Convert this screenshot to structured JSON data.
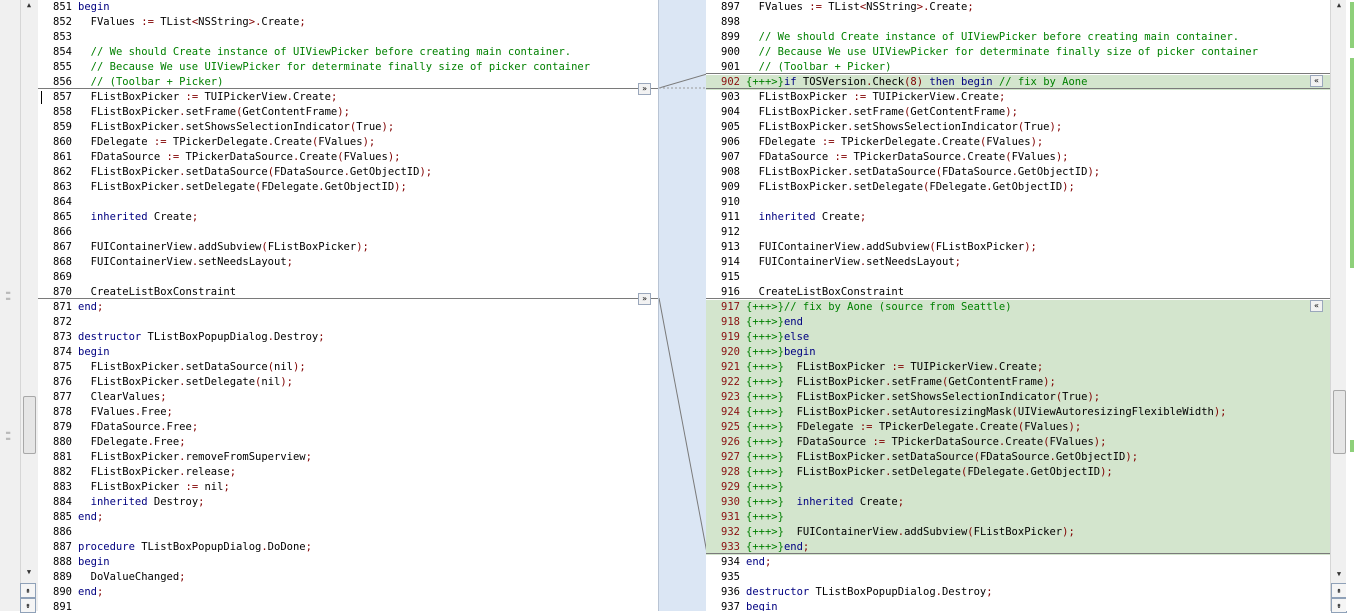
{
  "left": {
    "lines": [
      {
        "n": "851",
        "code": "begin"
      },
      {
        "n": "852",
        "code": "  FValues := TList<NSString>.Create;"
      },
      {
        "n": "853",
        "code": ""
      },
      {
        "n": "854",
        "code": "  // We should Create instance of UIViewPicker before creating main container."
      },
      {
        "n": "855",
        "code": "  // Because We use UIViewPicker for determinate finally size of picker container"
      },
      {
        "n": "856",
        "code": "  // (Toolbar + Picker)"
      },
      {
        "n": "857",
        "code": "  FListBoxPicker := TUIPickerView.Create;"
      },
      {
        "n": "858",
        "code": "  FListBoxPicker.setFrame(GetContentFrame);"
      },
      {
        "n": "859",
        "code": "  FListBoxPicker.setShowsSelectionIndicator(True);"
      },
      {
        "n": "860",
        "code": "  FDelegate := TPickerDelegate.Create(FValues);"
      },
      {
        "n": "861",
        "code": "  FDataSource := TPickerDataSource.Create(FValues);"
      },
      {
        "n": "862",
        "code": "  FListBoxPicker.setDataSource(FDataSource.GetObjectID);"
      },
      {
        "n": "863",
        "code": "  FListBoxPicker.setDelegate(FDelegate.GetObjectID);"
      },
      {
        "n": "864",
        "code": ""
      },
      {
        "n": "865",
        "code": "  inherited Create;"
      },
      {
        "n": "866",
        "code": ""
      },
      {
        "n": "867",
        "code": "  FUIContainerView.addSubview(FListBoxPicker);"
      },
      {
        "n": "868",
        "code": "  FUIContainerView.setNeedsLayout;"
      },
      {
        "n": "869",
        "code": ""
      },
      {
        "n": "870",
        "code": "  CreateListBoxConstraint"
      },
      {
        "n": "871",
        "code": "end;"
      },
      {
        "n": "872",
        "code": ""
      },
      {
        "n": "873",
        "code": "destructor TListBoxPopupDialog.Destroy;"
      },
      {
        "n": "874",
        "code": "begin"
      },
      {
        "n": "875",
        "code": "  FListBoxPicker.setDataSource(nil);"
      },
      {
        "n": "876",
        "code": "  FListBoxPicker.setDelegate(nil);"
      },
      {
        "n": "877",
        "code": "  ClearValues;"
      },
      {
        "n": "878",
        "code": "  FValues.Free;"
      },
      {
        "n": "879",
        "code": "  FDataSource.Free;"
      },
      {
        "n": "880",
        "code": "  FDelegate.Free;"
      },
      {
        "n": "881",
        "code": "  FListBoxPicker.removeFromSuperview;"
      },
      {
        "n": "882",
        "code": "  FListBoxPicker.release;"
      },
      {
        "n": "883",
        "code": "  FListBoxPicker := nil;"
      },
      {
        "n": "884",
        "code": "  inherited Destroy;"
      },
      {
        "n": "885",
        "code": "end;"
      },
      {
        "n": "886",
        "code": ""
      },
      {
        "n": "887",
        "code": "procedure TListBoxPopupDialog.DoDone;"
      },
      {
        "n": "888",
        "code": "begin"
      },
      {
        "n": "889",
        "code": "  DoValueChanged;"
      },
      {
        "n": "890",
        "code": "end;"
      },
      {
        "n": "891",
        "code": ""
      }
    ]
  },
  "right": {
    "lines": [
      {
        "n": "897",
        "code": "  FValues := TList<NSString>.Create;"
      },
      {
        "n": "898",
        "code": ""
      },
      {
        "n": "899",
        "code": "  // We should Create instance of UIViewPicker before creating main container."
      },
      {
        "n": "900",
        "code": "  // Because We use UIViewPicker for determinate finally size of picker container"
      },
      {
        "n": "901",
        "code": "  // (Toolbar + Picker)"
      },
      {
        "n": "902",
        "code": "{+++>}if TOSVersion.Check(8) then begin // fix by Aone",
        "hl": true
      },
      {
        "n": "903",
        "code": "  FListBoxPicker := TUIPickerView.Create;"
      },
      {
        "n": "904",
        "code": "  FListBoxPicker.setFrame(GetContentFrame);"
      },
      {
        "n": "905",
        "code": "  FListBoxPicker.setShowsSelectionIndicator(True);"
      },
      {
        "n": "906",
        "code": "  FDelegate := TPickerDelegate.Create(FValues);"
      },
      {
        "n": "907",
        "code": "  FDataSource := TPickerDataSource.Create(FValues);"
      },
      {
        "n": "908",
        "code": "  FListBoxPicker.setDataSource(FDataSource.GetObjectID);"
      },
      {
        "n": "909",
        "code": "  FListBoxPicker.setDelegate(FDelegate.GetObjectID);"
      },
      {
        "n": "910",
        "code": ""
      },
      {
        "n": "911",
        "code": "  inherited Create;"
      },
      {
        "n": "912",
        "code": ""
      },
      {
        "n": "913",
        "code": "  FUIContainerView.addSubview(FListBoxPicker);"
      },
      {
        "n": "914",
        "code": "  FUIContainerView.setNeedsLayout;"
      },
      {
        "n": "915",
        "code": ""
      },
      {
        "n": "916",
        "code": "  CreateListBoxConstraint"
      },
      {
        "n": "917",
        "code": "{+++>}// fix by Aone (source from Seattle)",
        "hl": true
      },
      {
        "n": "918",
        "code": "{+++>}end",
        "hl": true
      },
      {
        "n": "919",
        "code": "{+++>}else",
        "hl": true
      },
      {
        "n": "920",
        "code": "{+++>}begin",
        "hl": true
      },
      {
        "n": "921",
        "code": "{+++>}  FListBoxPicker := TUIPickerView.Create;",
        "hl": true
      },
      {
        "n": "922",
        "code": "{+++>}  FListBoxPicker.setFrame(GetContentFrame);",
        "hl": true
      },
      {
        "n": "923",
        "code": "{+++>}  FListBoxPicker.setShowsSelectionIndicator(True);",
        "hl": true
      },
      {
        "n": "924",
        "code": "{+++>}  FListBoxPicker.setAutoresizingMask(UIViewAutoresizingFlexibleWidth);",
        "hl": true
      },
      {
        "n": "925",
        "code": "{+++>}  FDelegate := TPickerDelegate.Create(FValues);",
        "hl": true
      },
      {
        "n": "926",
        "code": "{+++>}  FDataSource := TPickerDataSource.Create(FValues);",
        "hl": true
      },
      {
        "n": "927",
        "code": "{+++>}  FListBoxPicker.setDataSource(FDataSource.GetObjectID);",
        "hl": true
      },
      {
        "n": "928",
        "code": "{+++>}  FListBoxPicker.setDelegate(FDelegate.GetObjectID);",
        "hl": true
      },
      {
        "n": "929",
        "code": "{+++>}",
        "hl": true
      },
      {
        "n": "930",
        "code": "{+++>}  inherited Create;",
        "hl": true
      },
      {
        "n": "931",
        "code": "{+++>}",
        "hl": true
      },
      {
        "n": "932",
        "code": "{+++>}  FUIContainerView.addSubview(FListBoxPicker);",
        "hl": true
      },
      {
        "n": "933",
        "code": "{+++>}end;",
        "hl": true
      },
      {
        "n": "934",
        "code": "end;"
      },
      {
        "n": "935",
        "code": ""
      },
      {
        "n": "936",
        "code": "destructor TListBoxPopupDialog.Destroy;"
      },
      {
        "n": "937",
        "code": "begin"
      }
    ]
  },
  "buttons": {
    "copy_right": "»",
    "copy_left": "«"
  },
  "colors": {
    "added_bg": "#d3e5cd",
    "gutter_bg": "#dbe6f4"
  }
}
